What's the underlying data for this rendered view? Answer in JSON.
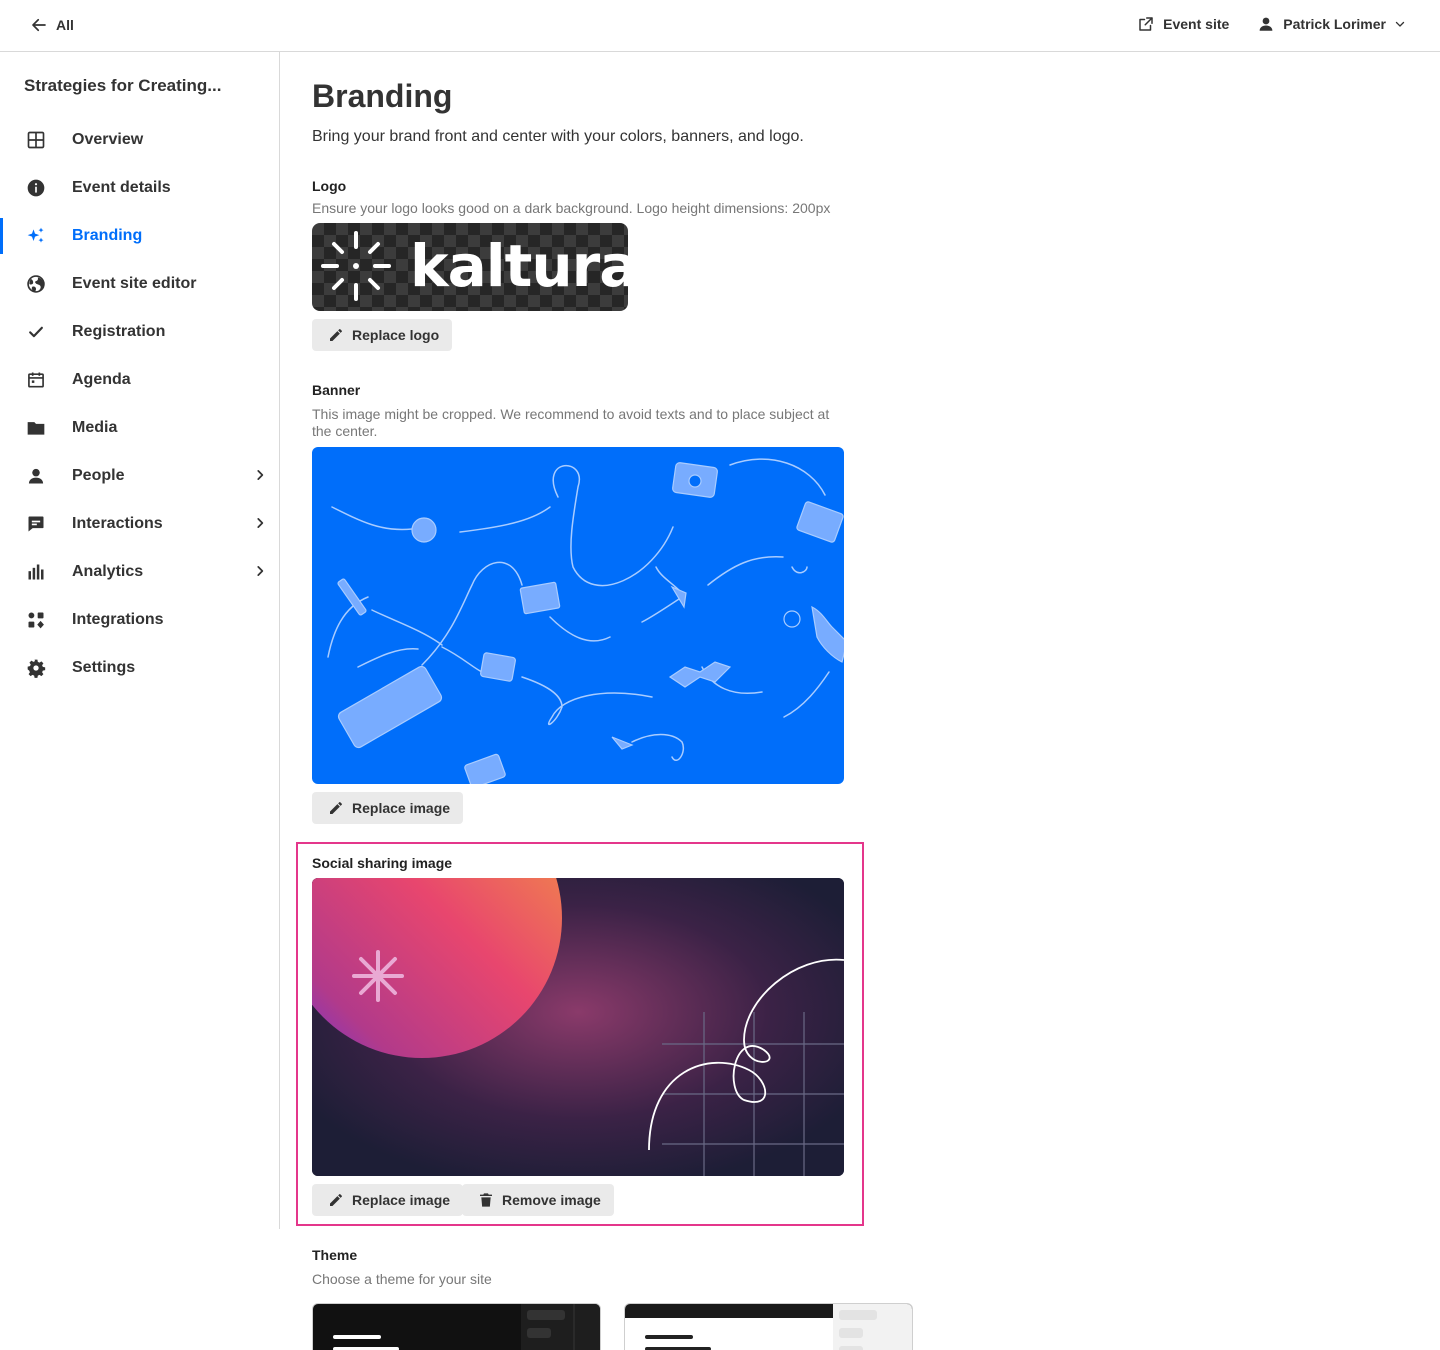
{
  "topbar": {
    "back_label": "All",
    "event_site_label": "Event site",
    "user_name": "Patrick Lorimer"
  },
  "sidebar": {
    "event_name": "Strategies for Creating...",
    "items": [
      {
        "label": "Overview",
        "icon": "grid-icon"
      },
      {
        "label": "Event details",
        "icon": "info-icon"
      },
      {
        "label": "Branding",
        "icon": "sparkle-icon",
        "active": true
      },
      {
        "label": "Event site editor",
        "icon": "globe-icon"
      },
      {
        "label": "Registration",
        "icon": "check-icon"
      },
      {
        "label": "Agenda",
        "icon": "calendar-icon"
      },
      {
        "label": "Media",
        "icon": "folder-icon"
      },
      {
        "label": "People",
        "icon": "person-icon",
        "has_submenu": true
      },
      {
        "label": "Interactions",
        "icon": "chat-icon",
        "has_submenu": true
      },
      {
        "label": "Analytics",
        "icon": "bar-chart-icon",
        "has_submenu": true
      },
      {
        "label": "Integrations",
        "icon": "integrations-icon"
      },
      {
        "label": "Settings",
        "icon": "gear-icon"
      }
    ]
  },
  "main": {
    "title": "Branding",
    "subtitle": "Bring your brand front and center with your colors, banners, and logo.",
    "logo": {
      "label": "Logo",
      "help": "Ensure your logo looks good on a dark background. Logo height dimensions: 200px",
      "logo_text": "kaltura",
      "button": "Replace logo"
    },
    "banner": {
      "label": "Banner",
      "help": "This image might be cropped. We recommend to avoid texts and to place subject at the center.",
      "button": "Replace image"
    },
    "social": {
      "label": "Social sharing image",
      "replace_button": "Replace image",
      "remove_button": "Remove image"
    },
    "theme": {
      "label": "Theme",
      "help": "Choose a theme for your site"
    }
  },
  "colors": {
    "accent": "#006EFA",
    "highlight_frame": "#e4368b",
    "banner_bg": "#006EFA"
  }
}
